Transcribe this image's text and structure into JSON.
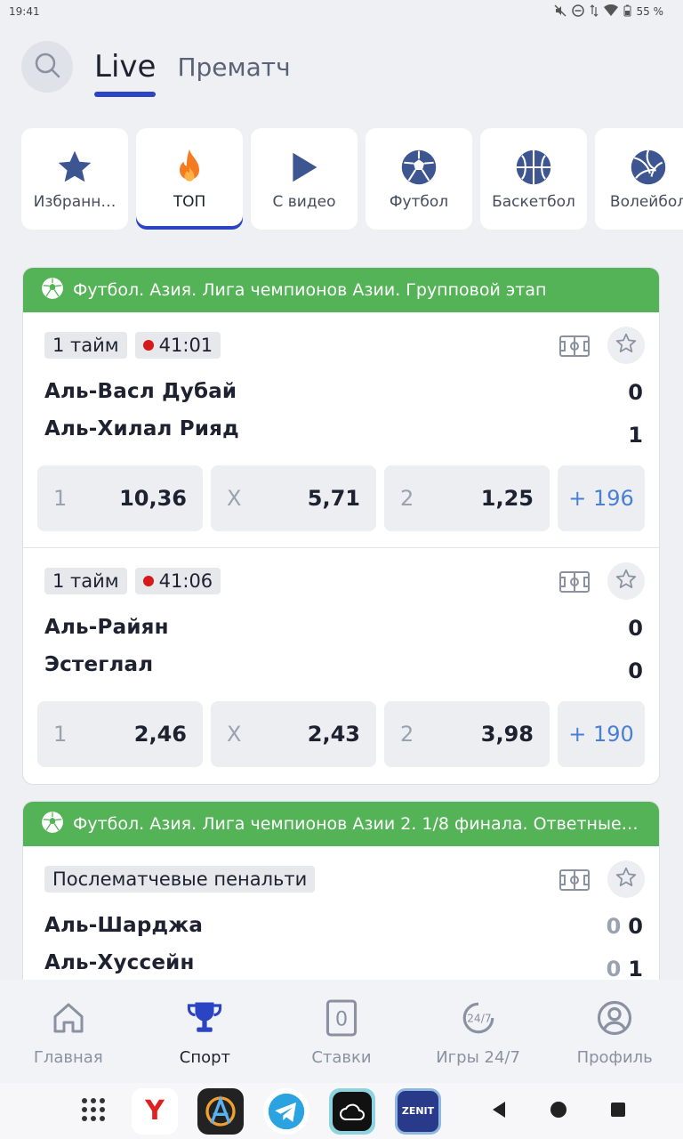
{
  "status": {
    "time": "19:41",
    "battery": "55 %"
  },
  "header": {
    "tab_live": "Live",
    "tab_prematch": "Прематч"
  },
  "categories": [
    {
      "label": "Избранн…",
      "icon": "star-icon"
    },
    {
      "label": "ТОП",
      "icon": "fire-icon",
      "active": true
    },
    {
      "label": "С видео",
      "icon": "play-icon"
    },
    {
      "label": "Футбол",
      "icon": "soccer-ball-icon"
    },
    {
      "label": "Баскетбол",
      "icon": "basketball-icon"
    },
    {
      "label": "Волейбол",
      "icon": "volleyball-icon"
    }
  ],
  "leagues": [
    {
      "title": "Футбол. Азия. Лига чемпионов Азии. Групповой этап",
      "matches": [
        {
          "period": "1 тайм",
          "time": "41:01",
          "team1": "Аль-Васл Дубай",
          "team2": "Аль-Хилал Рияд",
          "score1": "0",
          "score2": "1",
          "odds": [
            {
              "k": "1",
              "v": "10,36"
            },
            {
              "k": "X",
              "v": "5,71"
            },
            {
              "k": "2",
              "v": "1,25"
            }
          ],
          "more": "+ 196"
        },
        {
          "period": "1 тайм",
          "time": "41:06",
          "team1": "Аль-Райян",
          "team2": "Эстеглал",
          "score1": "0",
          "score2": "0",
          "odds": [
            {
              "k": "1",
              "v": "2,46"
            },
            {
              "k": "X",
              "v": "2,43"
            },
            {
              "k": "2",
              "v": "3,98"
            }
          ],
          "more": "+ 190"
        }
      ]
    },
    {
      "title": "Футбол. Азия. Лига чемпионов Азии 2. 1/8 финала. Ответные м...",
      "matches": [
        {
          "period": "Послематчевые пенальти",
          "team1": "Аль-Шарджа",
          "team2": "Аль-Хуссейн",
          "score1_prev": "0",
          "score1": "0",
          "score2_prev": "0",
          "score2": "1"
        }
      ]
    }
  ],
  "bottom_nav": [
    {
      "label": "Главная",
      "icon": "home-icon"
    },
    {
      "label": "Спорт",
      "icon": "trophy-icon",
      "active": true
    },
    {
      "label": "Ставки",
      "icon": "bets-icon",
      "badge": "0"
    },
    {
      "label": "Игры 24/7",
      "icon": "games-24-7-icon",
      "badge": "24/7"
    },
    {
      "label": "Профиль",
      "icon": "profile-icon"
    }
  ],
  "dock_apps": [
    {
      "name": "Яндекс",
      "text": "Y"
    },
    {
      "name": "Anarchy"
    },
    {
      "name": "Telegram"
    },
    {
      "name": "Cloud"
    },
    {
      "name": "Zenit",
      "text": "ZENIT"
    }
  ],
  "colors": {
    "accent": "#2b44c4",
    "league_green": "#53b356",
    "more_link": "#4a7fd6",
    "live_dot": "#d61a1a"
  }
}
